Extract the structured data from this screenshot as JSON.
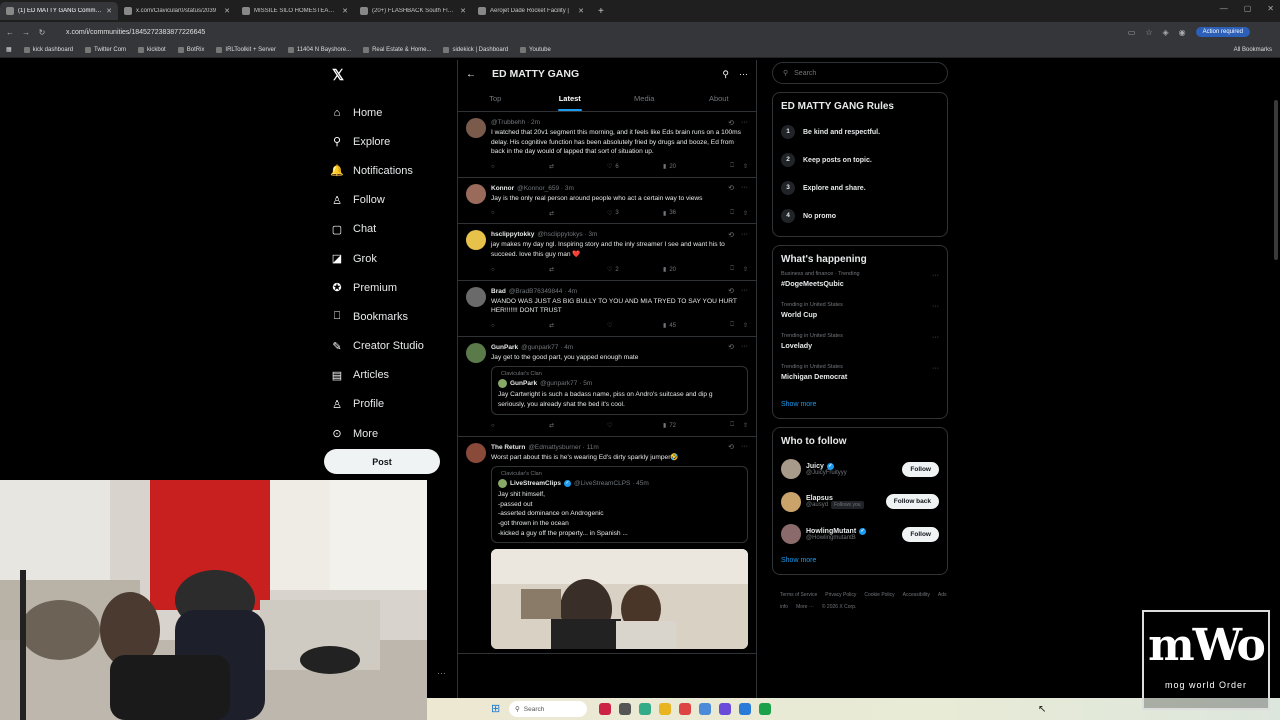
{
  "browser": {
    "tabs": [
      {
        "title": "(1) ED MATTY GANG Community",
        "active": true
      },
      {
        "title": "x.com/Clavicular0/status/2039",
        "active": false
      },
      {
        "title": "MISSILE SILO HOMESTEAD - G",
        "active": false
      },
      {
        "title": "(20+) FLASHBACK South Florid",
        "active": false
      },
      {
        "title": "Aerojet Dade Rocket Facility |",
        "active": false
      }
    ],
    "url": "x.com/i/communities/1845272383877226645",
    "action_required": "Action required",
    "bookmarks": [
      "kick dashboard",
      "Twitter Com",
      "kickbot",
      "BotRix",
      "IRLToolkit + Server",
      "11404 N Bayshore...",
      "Real Estate & Home...",
      "sidekick | Dashboard",
      "Youtube"
    ],
    "all_bookmarks": "All Bookmarks"
  },
  "nav": {
    "items": [
      {
        "label": "Home",
        "icon": "home-icon",
        "glyph": "⌂"
      },
      {
        "label": "Explore",
        "icon": "search-icon",
        "glyph": "⚲"
      },
      {
        "label": "Notifications",
        "icon": "bell-icon",
        "glyph": "🔔"
      },
      {
        "label": "Follow",
        "icon": "follow-icon",
        "glyph": "♙"
      },
      {
        "label": "Chat",
        "icon": "chat-icon",
        "glyph": "▢"
      },
      {
        "label": "Grok",
        "icon": "grok-icon",
        "glyph": "◪"
      },
      {
        "label": "Premium",
        "icon": "premium-icon",
        "glyph": "✪"
      },
      {
        "label": "Bookmarks",
        "icon": "bookmark-icon",
        "glyph": "⎕"
      },
      {
        "label": "Creator Studio",
        "icon": "creator-icon",
        "glyph": "✎"
      },
      {
        "label": "Articles",
        "icon": "articles-icon",
        "glyph": "▤"
      },
      {
        "label": "Profile",
        "icon": "profile-icon",
        "glyph": "♙"
      },
      {
        "label": "More",
        "icon": "more-icon",
        "glyph": "⊙"
      }
    ],
    "post": "Post"
  },
  "community": {
    "title": "ED MATTY GANG",
    "tabs": [
      "Top",
      "Latest",
      "Media",
      "About"
    ],
    "active_tab": "Latest"
  },
  "tweets": [
    {
      "name": "",
      "handle": "@Trubbehh · 2m",
      "text": "I watched that 20v1 segment this morning, and it feels like Eds brain runs on a 100ms delay. His cognitive function has been absolutely fried by drugs and booze, Ed from back in the day would of lapped that sort of situation up.",
      "likes": "6",
      "views": "20",
      "avatar": "#7a5a4a"
    },
    {
      "name": "Konnor",
      "handle": "@Konnor_659 · 3m",
      "text": "Jay is the only real person around people who act a certain way to views",
      "likes": "3",
      "views": "36",
      "avatar": "#9a6b5a"
    },
    {
      "name": "hsclippytokky",
      "handle": "@hsclippytokys · 3m",
      "text": "jay makes my day ngl. Inspiring story and the inly streamer I see and want his to succeed. love this guy man ❤️",
      "likes": "2",
      "views": "20",
      "avatar": "#e6c24a"
    },
    {
      "name": "Brad",
      "handle": "@BradB76349844 · 4m",
      "text": "WANDO WAS JUST AS BIG BULLY TO YOU AND MIA TRYED TO SAY YOU HURT HER!!!!!!!    DONT TRUST",
      "likes": "",
      "views": "45",
      "avatar": "#6a6a6a"
    },
    {
      "name": "GunPark",
      "handle": "@gunpark77 · 4m",
      "text": "Jay get to the good part, you yapped enough mate",
      "likes": "",
      "views": "72",
      "avatar": "#5a7a4a",
      "quote": {
        "clan": "Clavicular's Clan",
        "name": "GunPark",
        "handle": "@gunpark77 · 5m",
        "text": "Jay Cartwright is such a badass name, piss on Andro's suitcase and dip g seriously, you already shat the bed it's cool."
      }
    },
    {
      "name": "The Return",
      "handle": "@Edmattysburner · 11m",
      "text": "Worst part about this is he's wearing Ed's dirty sparkly jumper🤣",
      "avatar": "#8a4a3a",
      "quote": {
        "clan": "Clavicular's Clan",
        "name": "LiveStreamClips",
        "handle": "@LiveStreamCLPS · 45m",
        "text": "Jay shit himself,\n-passed out\n-asserted dominance on Androgenic\n-got thrown in the ocean\n-kicked a guy off the property... in Spanish ..."
      }
    }
  ],
  "search": {
    "placeholder": "Search"
  },
  "rules": {
    "title": "ED MATTY GANG Rules",
    "items": [
      {
        "num": "1",
        "text": "Be kind and respectful."
      },
      {
        "num": "2",
        "text": "Keep posts on topic."
      },
      {
        "num": "3",
        "text": "Explore and share."
      },
      {
        "num": "4",
        "text": "No promo"
      }
    ]
  },
  "happening": {
    "title": "What's happening",
    "items": [
      {
        "meta": "Business and finance · Trending",
        "name": "#DogeMeetsQubic"
      },
      {
        "meta": "Trending in United States",
        "name": "World Cup"
      },
      {
        "meta": "Trending in United States",
        "name": "Lovelady"
      },
      {
        "meta": "Trending in United States",
        "name": "Michigan Democrat"
      }
    ],
    "show_more": "Show more"
  },
  "who_to_follow": {
    "title": "Who to follow",
    "items": [
      {
        "name": "Juicy",
        "handle": "@JuicyFruityyy",
        "button": "Follow",
        "verified": true,
        "follows_you": "",
        "avatar": "#a89a8a"
      },
      {
        "name": "Elapsus",
        "handle": "@ausyd",
        "button": "Follow back",
        "verified": false,
        "follows_you": "Follows you",
        "avatar": "#c9a36a"
      },
      {
        "name": "HowlingMutant",
        "handle": "@HowlingmutantB",
        "button": "Follow",
        "verified": true,
        "follows_you": "",
        "avatar": "#8a6a6a"
      }
    ],
    "show_more": "Show more"
  },
  "footer": [
    "Terms of Service",
    "Privacy Policy",
    "Cookie Policy",
    "Accessibility",
    "Ads info",
    "More ···",
    "© 2026 X Corp."
  ],
  "taskbar": {
    "search": "Search"
  },
  "watermark": {
    "big": "mWo",
    "small": "mog world Order"
  }
}
